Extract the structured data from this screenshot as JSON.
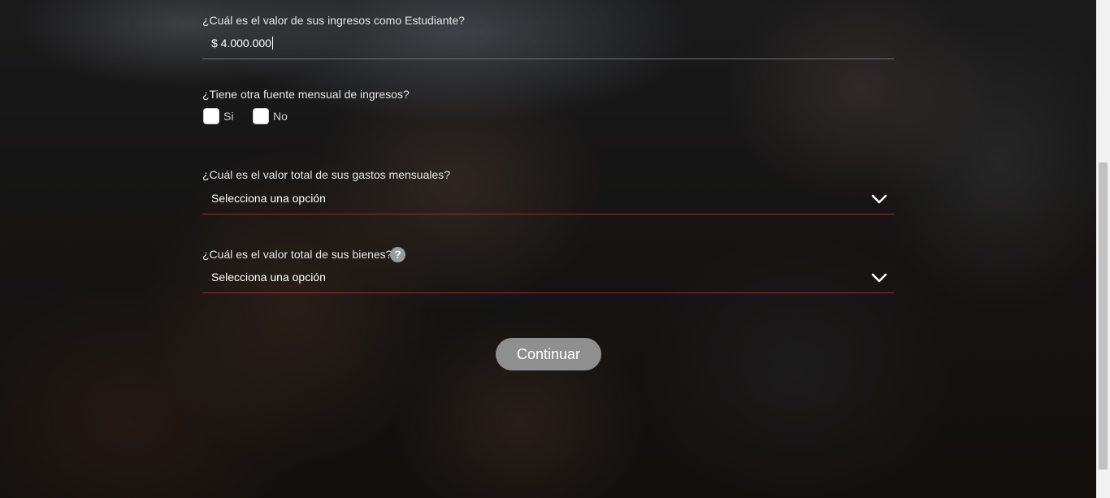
{
  "form": {
    "income_question": "¿Cuál es el valor de sus ingresos como Estudiante?",
    "income_value": "$ 4.000.000",
    "other_income_question": "¿Tiene otra fuente mensual de ingresos?",
    "other_income_options": [
      "Si",
      "No"
    ],
    "expenses_question": "¿Cuál es el valor total de sus gastos mensuales?",
    "expenses_selected": "Selecciona una opción",
    "assets_question": "¿Cuál es el valor total de sus bienes?",
    "assets_selected": "Selecciona una opción",
    "help_glyph": "?"
  },
  "actions": {
    "continue_label": "Continuar"
  },
  "colors": {
    "accent_red": "#c8102e",
    "button_gray": "#8f8f8f"
  },
  "icons": {
    "select_arrow": "chevron-down-icon",
    "help": "question-mark-icon"
  }
}
